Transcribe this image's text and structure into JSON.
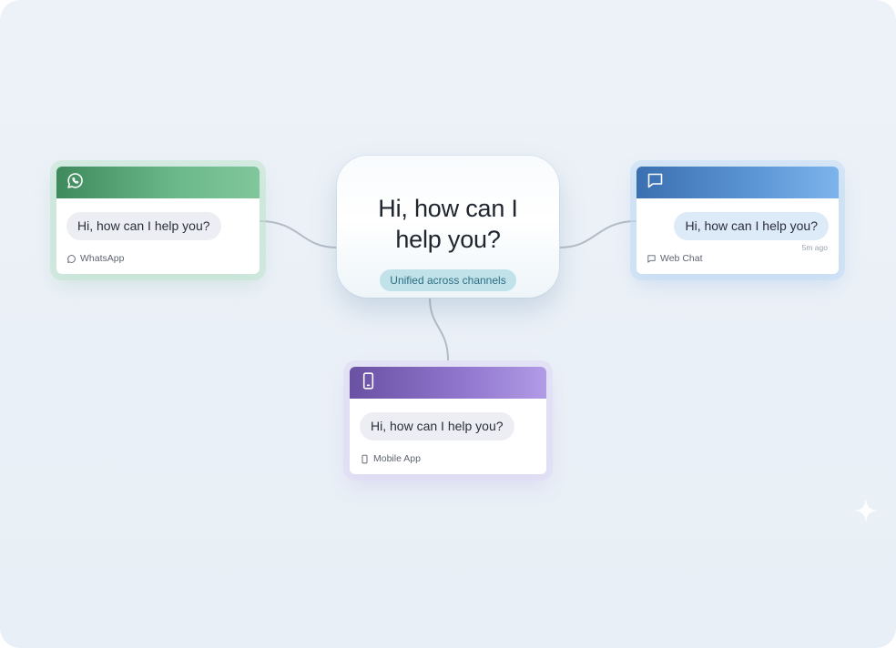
{
  "center": {
    "title_line1": "Hi, how can I",
    "title_line2": "help you?",
    "badge": "Unified across channels"
  },
  "channels": {
    "whatsapp": {
      "message": "Hi, how can I help you?",
      "label": "WhatsApp",
      "icon": "whatsapp-icon",
      "color": "#4f9a6d"
    },
    "webchat": {
      "message": "Hi, how can I help you?",
      "label": "Web Chat",
      "timestamp": "5m ago",
      "icon": "chat-bubble-icon",
      "color": "#4a82c5"
    },
    "mobile": {
      "message": "Hi, how can I help you?",
      "label": "Mobile App",
      "icon": "smartphone-icon",
      "color": "#7d63bd"
    }
  }
}
